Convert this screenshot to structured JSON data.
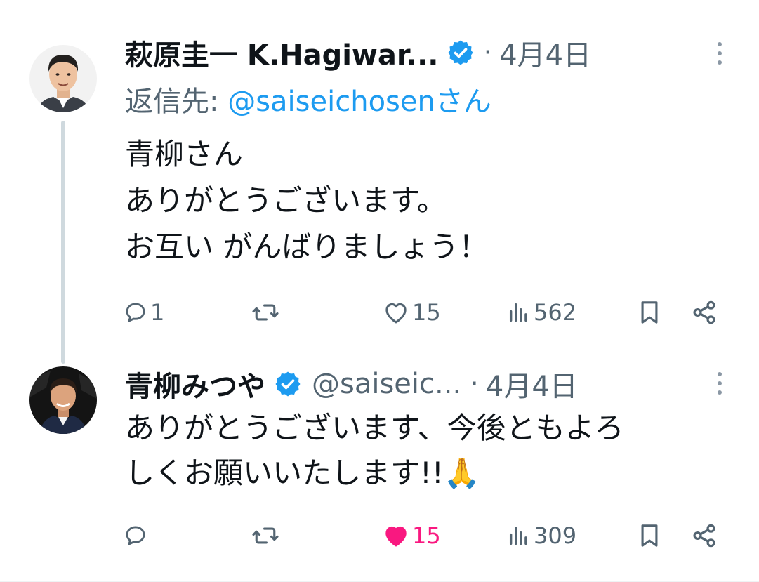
{
  "tweets": [
    {
      "author_name": "萩原圭一 K.Hagiwar...",
      "handle": "",
      "separator": "·",
      "time": "4月4日",
      "reply_prefix": "返信先: ",
      "reply_mention": "@saiseichosenさん",
      "lines": [
        "青柳さん",
        "ありがとうございます。",
        "お互い がんばりましょう！"
      ],
      "stats": {
        "replies": "1",
        "retweets": "",
        "likes": "15",
        "views": "562"
      },
      "liked": false
    },
    {
      "author_name": "青柳みつや",
      "handle": "@saiseic...",
      "separator": "·",
      "time": "4月4日",
      "lines": [
        "ありがとうございます、今後ともよろ",
        "しくお願いいたします!!🙏"
      ],
      "stats": {
        "replies": "",
        "retweets": "",
        "likes": "15",
        "views": "309"
      },
      "liked": true
    }
  ],
  "colors": {
    "verified": "#1d9bf0",
    "link": "#1d9bf0",
    "like_active": "#f91880",
    "secondary_text": "#536471"
  },
  "icons": [
    "verified-badge-icon",
    "more-icon",
    "reply-icon",
    "retweet-icon",
    "like-icon",
    "views-icon",
    "bookmark-icon",
    "share-icon"
  ]
}
